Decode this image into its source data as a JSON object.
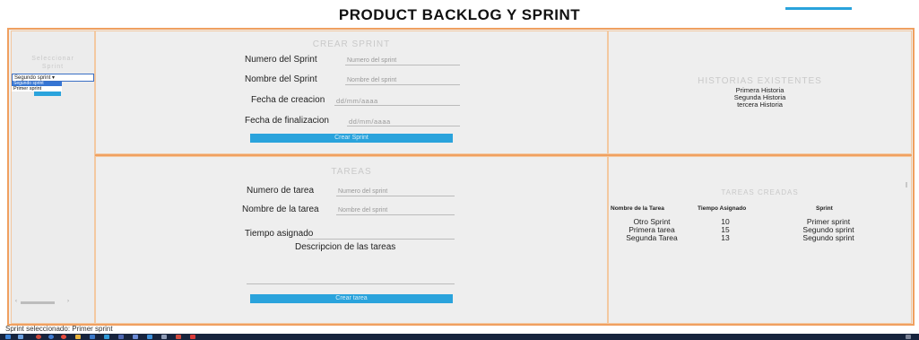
{
  "page": {
    "title": "PRODUCT BACKLOG Y SPRINT"
  },
  "left": {
    "title_line1": "Seleccionar",
    "title_line2": "Sprint",
    "select_value": "Segundo sprint ▾",
    "options": [
      "Segundo sprint",
      "Primer sprint"
    ]
  },
  "sprint": {
    "title": "CREAR SPRINT",
    "number_label": "Numero del Sprint",
    "number_placeholder": "Numero del sprint",
    "name_label": "Nombre del Sprint",
    "name_placeholder": "Nombre del sprint",
    "creation_label": "Fecha de creacion",
    "creation_placeholder": "dd/mm/aaaa",
    "end_label": "Fecha de finalizacion",
    "end_placeholder": "dd/mm/aaaa",
    "button": "Crear Sprint"
  },
  "stories": {
    "title": "HISTORIAS EXISTENTES",
    "items": [
      "Primera Historia",
      "Segunda Historia",
      "tercera Historia"
    ]
  },
  "tasks": {
    "title": "TAREAS",
    "number_label": "Numero de tarea",
    "number_placeholder": "Numero del sprint",
    "name_label": "Nombre de la tarea",
    "name_placeholder": "Nombre del sprint",
    "time_label": "Tiempo asignado",
    "desc_label": "Descripcion de las tareas",
    "button": "Crear tarea"
  },
  "table": {
    "title": "TAREAS CREADAS",
    "headers": [
      "Nombre de la Tarea",
      "Tiempo Asignado",
      "Sprint"
    ],
    "rows": [
      [
        "Otro Sprint",
        "10",
        "Primer sprint"
      ],
      [
        "Primera tarea",
        "15",
        "Segundo sprint"
      ],
      [
        "Segunda Tarea",
        "13",
        "Segundo sprint"
      ]
    ]
  },
  "status": {
    "text": "Sprint seleccionado: Primer sprint"
  },
  "colors": {
    "accent": "#2aa3dc",
    "border": "#f0a060",
    "taskbar": "#17243d"
  }
}
